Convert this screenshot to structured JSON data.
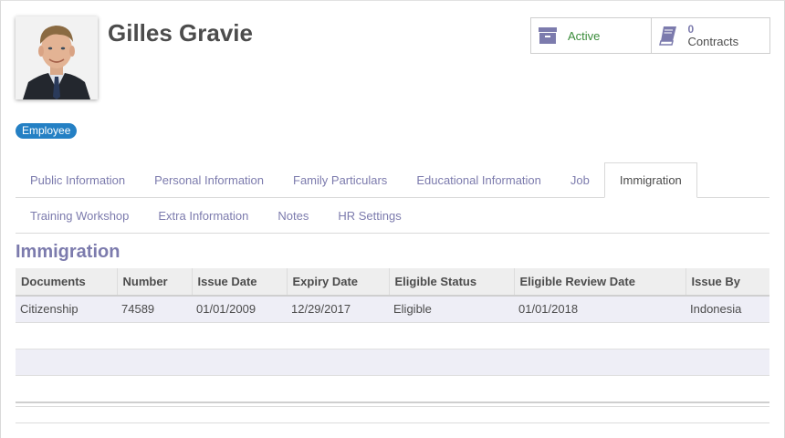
{
  "employee": {
    "name": "Gilles Gravie",
    "tag": "Employee"
  },
  "smart_buttons": {
    "active_label": "Active",
    "contracts_count": "0",
    "contracts_label": "Contracts"
  },
  "tabs": {
    "row1": [
      {
        "label": "Public Information"
      },
      {
        "label": "Personal Information"
      },
      {
        "label": "Family Particulars"
      },
      {
        "label": "Educational Information"
      },
      {
        "label": "Job"
      },
      {
        "label": "Immigration"
      }
    ],
    "row2": [
      {
        "label": "Training Workshop"
      },
      {
        "label": "Extra Information"
      },
      {
        "label": "Notes"
      },
      {
        "label": "HR Settings"
      }
    ],
    "active": "Immigration"
  },
  "section": {
    "title": "Immigration"
  },
  "table": {
    "columns": [
      "Documents",
      "Number",
      "Issue Date",
      "Expiry Date",
      "Eligible Status",
      "Eligible Review Date",
      "Issue By"
    ],
    "rows": [
      [
        "Citizenship",
        "74589",
        "01/01/2009",
        "12/29/2017",
        "Eligible",
        "01/01/2018",
        "Indonesia"
      ]
    ]
  },
  "colors": {
    "accent": "#7c7bad",
    "tag_bg": "#2480c4",
    "active_green": "#3a8c3a"
  },
  "icons": {
    "active": "archive-box-icon",
    "contracts": "book-icon"
  }
}
